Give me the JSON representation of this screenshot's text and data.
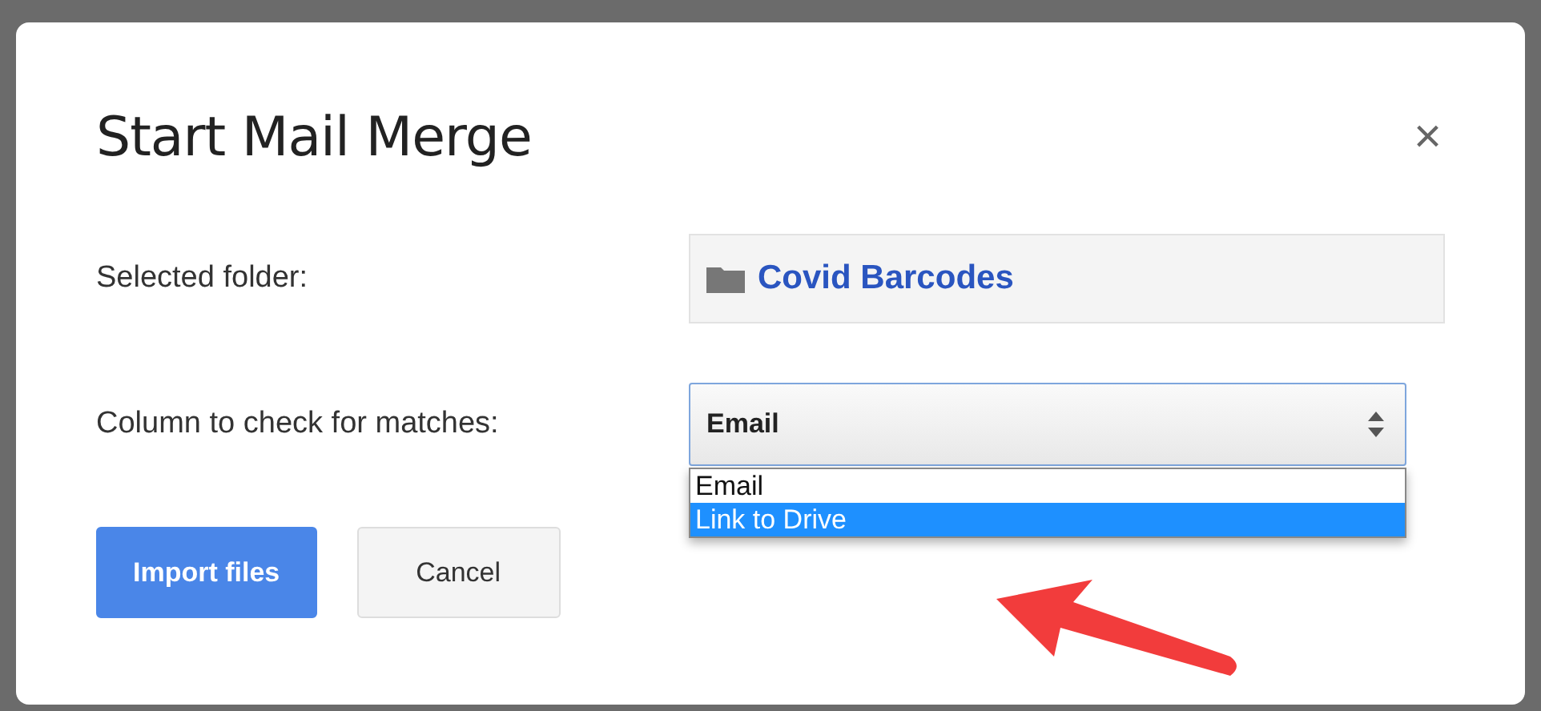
{
  "dialog": {
    "title": "Start Mail Merge",
    "close": "×"
  },
  "folder": {
    "label": "Selected folder:",
    "name": "Covid Barcodes"
  },
  "column": {
    "label": "Column to check for matches:",
    "value": "Email",
    "options": [
      {
        "label": "Email",
        "highlighted": false
      },
      {
        "label": "Link to Drive",
        "highlighted": true
      }
    ]
  },
  "buttons": [
    {
      "label": "Import files",
      "kind": "primary"
    },
    {
      "label": "Cancel",
      "kind": "secondary"
    }
  ]
}
